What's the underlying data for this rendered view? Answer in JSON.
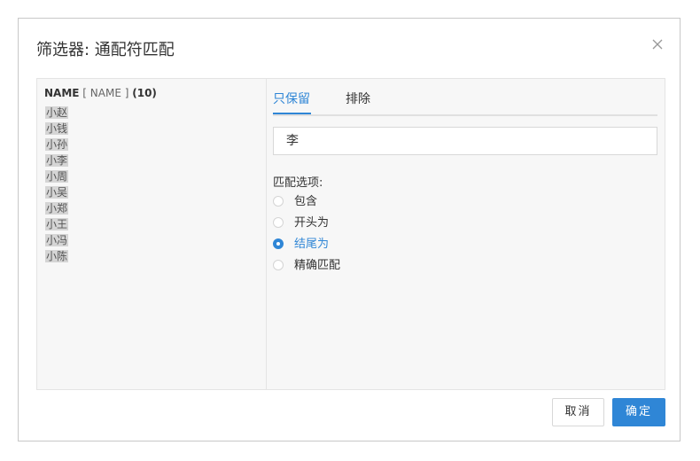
{
  "dialog": {
    "title": "筛选器: 通配符匹配"
  },
  "field": {
    "name_bold": "NAME",
    "name_bracket": "[ NAME ]",
    "count": "(10)",
    "items": [
      "小赵",
      "小钱",
      "小孙",
      "小李",
      "小周",
      "小吴",
      "小郑",
      "小王",
      "小冯",
      "小陈"
    ]
  },
  "tabs": {
    "keep": "只保留",
    "exclude": "排除",
    "active": "keep"
  },
  "search": {
    "value": "李"
  },
  "match": {
    "label": "匹配选项:",
    "options": [
      "包含",
      "开头为",
      "结尾为",
      "精确匹配"
    ],
    "selected_index": 2
  },
  "buttons": {
    "cancel": "取消",
    "ok": "确定"
  },
  "colors": {
    "accent": "#2f86d6"
  }
}
